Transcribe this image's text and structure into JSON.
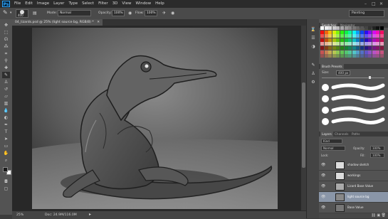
{
  "app": {
    "logo": "Ps"
  },
  "menu": [
    "File",
    "Edit",
    "Image",
    "Layer",
    "Type",
    "Select",
    "Filter",
    "3D",
    "View",
    "Window",
    "Help"
  ],
  "window_controls": {
    "minimize": "–",
    "restore": "□",
    "close": "✕"
  },
  "options_bar": {
    "brush_size": "400",
    "mode_label": "Mode:",
    "mode_value": "Normal",
    "opacity_label": "Opacity:",
    "opacity_value": "100%",
    "flow_label": "Flow:",
    "flow_value": "100%",
    "workspace": "Painting"
  },
  "document_tab": {
    "title": "04_lizards.psd @ 25% (light source bg, RGB/8) *"
  },
  "status_bar": {
    "zoom": "25%",
    "doc": "Doc: 24.9M/116.0M"
  },
  "colors": {
    "foreground": "#1a1a1a",
    "background": "#ffffff",
    "accent_selected": "#8a96a8"
  },
  "swatches_panel": {
    "tabs": [
      "Swatches",
      "Navigator"
    ]
  },
  "brush_panel": {
    "tabs": [
      "Brush Presets"
    ],
    "size_label": "Size:",
    "size_value": "400 px"
  },
  "layers_panel": {
    "tabs": [
      "Layers",
      "Channels",
      "Paths"
    ],
    "kind": "Kind",
    "blend_mode": "Normal",
    "opacity_label": "Opacity:",
    "opacity_value": "100%",
    "lock_label": "Lock:",
    "fill_label": "Fill:",
    "fill_value": "100%",
    "layers": [
      {
        "name": "shadow sketch",
        "selected": false
      },
      {
        "name": "workings",
        "selected": false
      },
      {
        "name": "Lizard Base Value",
        "selected": false
      },
      {
        "name": "light source bg",
        "selected": true
      },
      {
        "name": "Base Value",
        "selected": false
      }
    ]
  },
  "tool_icons": [
    "move-icon",
    "marquee-icon",
    "lasso-icon",
    "quick-select-icon",
    "crop-icon",
    "eyedropper-icon",
    "healing-icon",
    "brush-icon",
    "clone-stamp-icon",
    "history-brush-icon",
    "eraser-icon",
    "gradient-icon",
    "blur-icon",
    "dodge-icon",
    "pen-icon",
    "type-icon",
    "path-select-icon",
    "shape-icon",
    "hand-icon",
    "zoom-icon"
  ]
}
